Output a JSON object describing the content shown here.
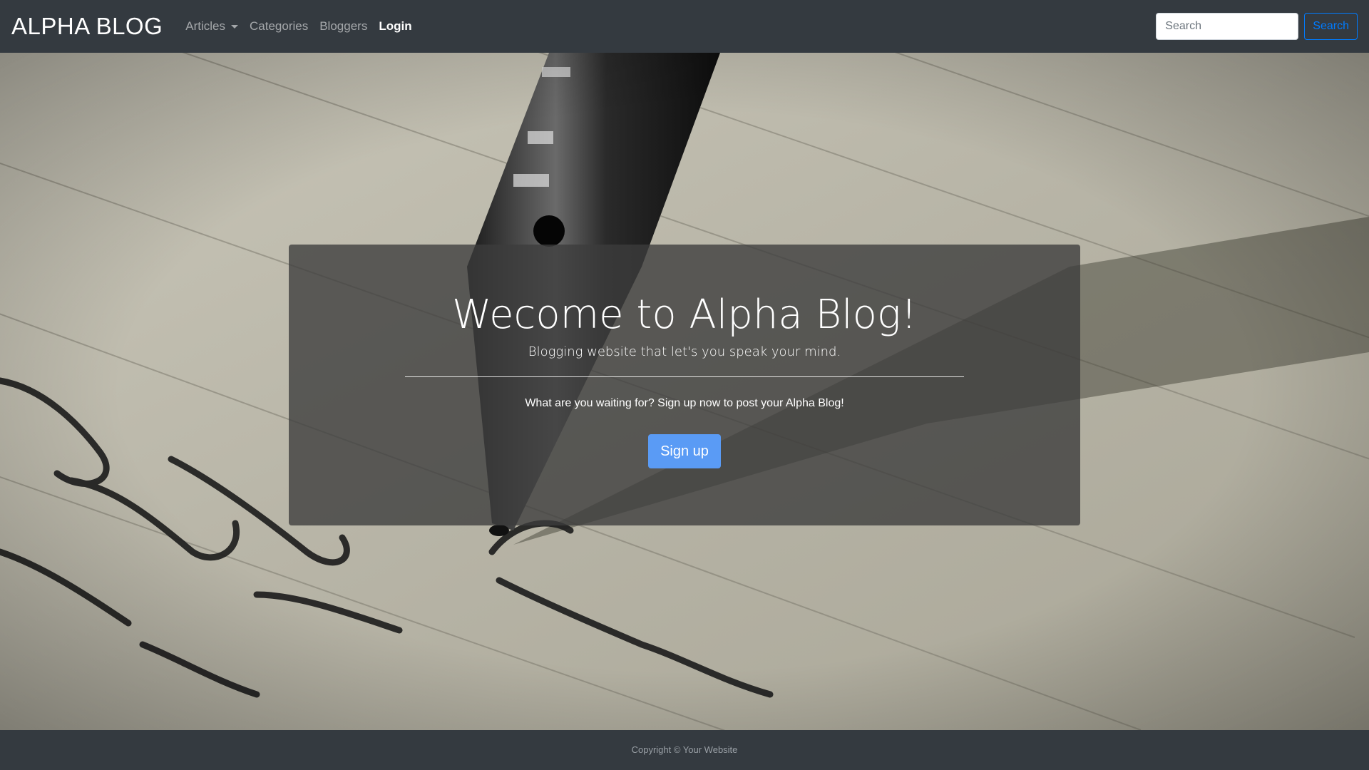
{
  "navbar": {
    "brand": "ALPHA BLOG",
    "links": {
      "articles": "Articles",
      "categories": "Categories",
      "bloggers": "Bloggers",
      "login": "Login"
    },
    "search": {
      "placeholder": "Search",
      "button_label": "Search"
    }
  },
  "hero": {
    "title": "Wecome to Alpha Blog!",
    "lead": "Blogging website that let's you speak your mind.",
    "cta_text": "What are you waiting for? Sign up now to post your Alpha Blog!",
    "signup_label": "Sign up"
  },
  "footer": {
    "copyright": "Copyright © Your Website"
  },
  "colors": {
    "navbar": "#343a40",
    "primary": "#007bff",
    "signup_button": "#5a9bf5",
    "jumbotron_overlay": "rgba(60,60,60,0.78)"
  },
  "icons": {
    "articles_dropdown": "caret-down-icon"
  }
}
